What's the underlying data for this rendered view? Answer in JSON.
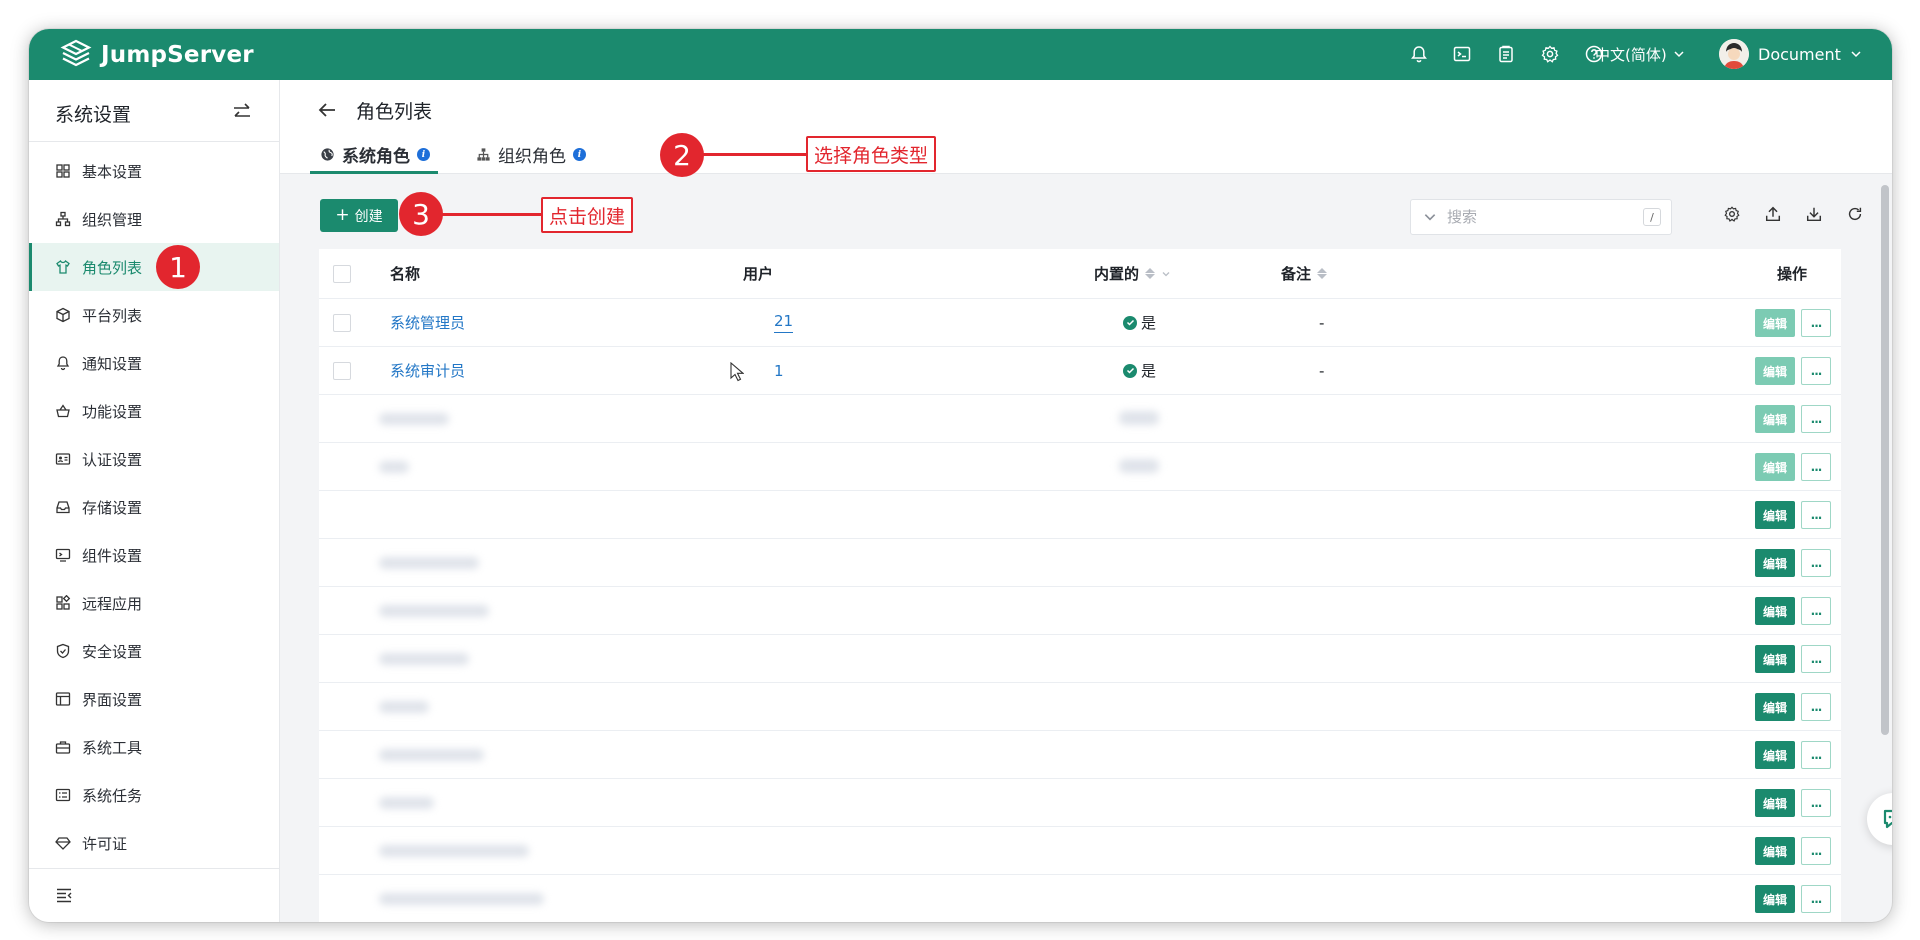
{
  "app": {
    "brand": "JumpServer",
    "language": "中文(简体)",
    "user_name": "Document"
  },
  "header_icons": [
    "bell-icon",
    "terminal-icon",
    "clipboard-icon",
    "settings-icon",
    "help-icon"
  ],
  "sidebar": {
    "title": "系统设置",
    "items": [
      {
        "label": "基本设置",
        "icon": "grid-icon"
      },
      {
        "label": "组织管理",
        "icon": "org-tree-icon"
      },
      {
        "label": "角色列表",
        "icon": "shirt-icon",
        "active": true
      },
      {
        "label": "平台列表",
        "icon": "cube-icon"
      },
      {
        "label": "通知设置",
        "icon": "bell-icon"
      },
      {
        "label": "功能设置",
        "icon": "basket-icon"
      },
      {
        "label": "认证设置",
        "icon": "id-card-icon"
      },
      {
        "label": "存储设置",
        "icon": "inbox-icon"
      },
      {
        "label": "组件设置",
        "icon": "monitor-icon"
      },
      {
        "label": "远程应用",
        "icon": "apps-icon"
      },
      {
        "label": "安全设置",
        "icon": "shield-icon"
      },
      {
        "label": "界面设置",
        "icon": "layout-icon"
      },
      {
        "label": "系统工具",
        "icon": "toolbox-icon"
      },
      {
        "label": "系统任务",
        "icon": "task-list-icon"
      },
      {
        "label": "许可证",
        "icon": "diamond-icon"
      }
    ]
  },
  "page": {
    "title": "角色列表",
    "tabs": [
      {
        "label": "系统角色",
        "active": true
      },
      {
        "label": "组织角色",
        "active": false
      }
    ]
  },
  "toolbar": {
    "create_label": "创建",
    "search_placeholder": "搜索",
    "search_shortcut": "/"
  },
  "table": {
    "columns": [
      "名称",
      "用户",
      "内置的",
      "备注",
      "操作"
    ],
    "rows": [
      {
        "name": "系统管理员",
        "users": "21",
        "builtin": "是",
        "comment": "-",
        "edit": "编辑",
        "more": "..."
      },
      {
        "name": "系统审计员",
        "users": "1",
        "builtin": "是",
        "comment": "-",
        "edit": "编辑",
        "more": "..."
      }
    ],
    "blurred_row_actions": {
      "edit": "编辑",
      "more": "..."
    },
    "blurred_row_count": 11
  },
  "annotations": [
    {
      "number": "1"
    },
    {
      "number": "2",
      "text": "选择角色类型"
    },
    {
      "number": "3",
      "text": "点击创建"
    }
  ],
  "colors": {
    "brand": "#1b8a6e",
    "link": "#2377c6",
    "annotation": "#e2262e"
  }
}
